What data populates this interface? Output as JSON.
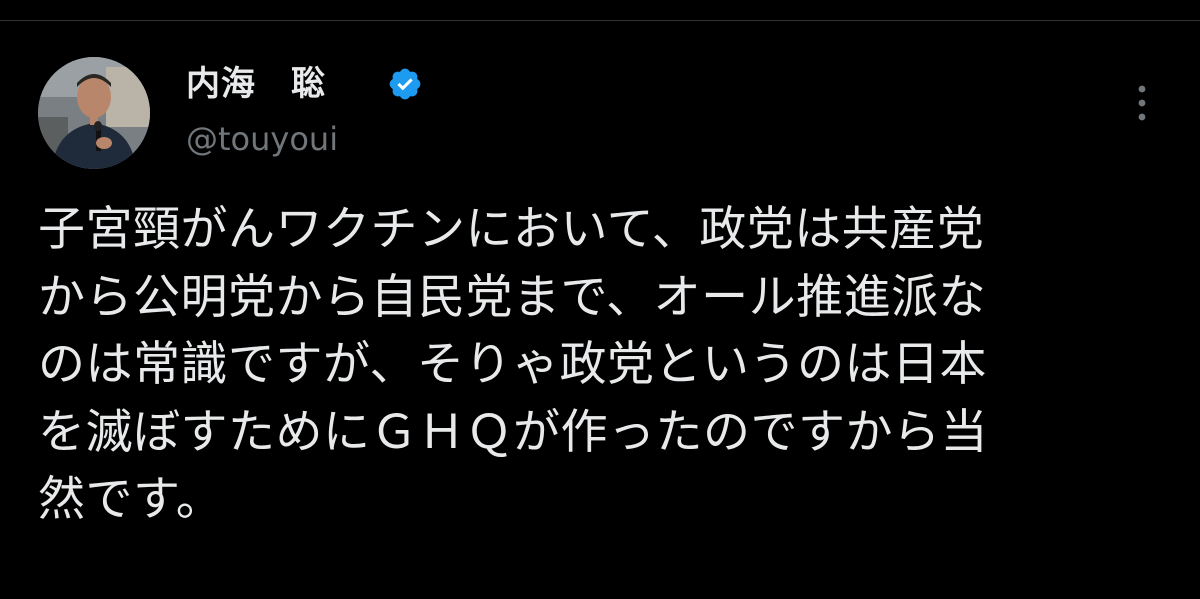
{
  "author": {
    "display_name": "内海　聡",
    "handle": "@touyoui",
    "verified": true,
    "avatar_icon": "profile-photo"
  },
  "tweet": {
    "lines": [
      "子宮頸がんワクチンにおいて、政党は共産党",
      "から公明党から自民党まで、オール推進派な",
      "のは常識ですが、そりゃ政党というのは日本",
      "を滅ぼすためにＧＨＱが作ったのですから当",
      "然です。"
    ]
  },
  "icons": {
    "verified": "verified-badge-icon",
    "more": "more-options-icon"
  },
  "colors": {
    "background": "#000000",
    "text": "#e7e9ea",
    "secondary": "#71767b",
    "verified": "#1d9bf0"
  }
}
